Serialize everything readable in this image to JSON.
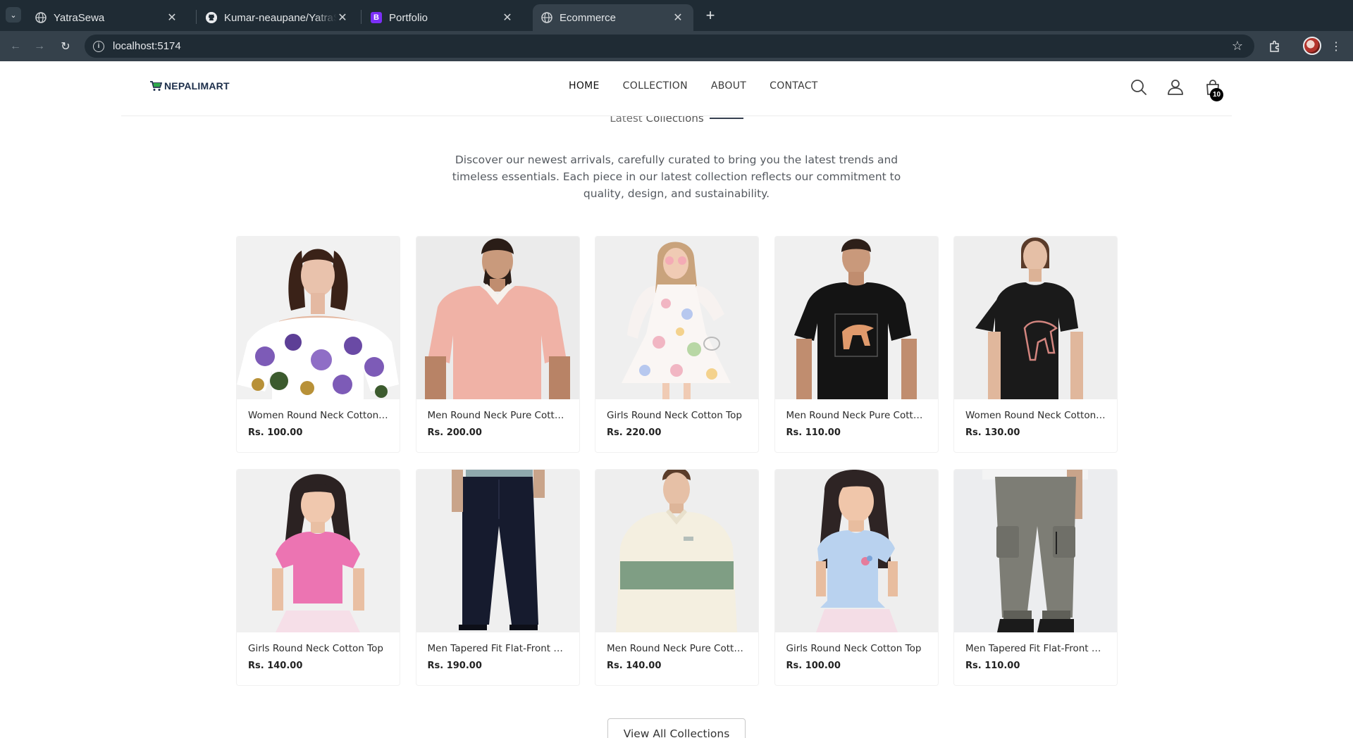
{
  "browser": {
    "tabs": [
      {
        "title": "YatraSewa",
        "icon": "globe-icon",
        "active": false
      },
      {
        "title": "Kumar-neaupane/YatraS",
        "icon": "github-icon",
        "active": false
      },
      {
        "title": "Portfolio",
        "icon": "bootstrap-icon",
        "active": false
      },
      {
        "title": "Ecommerce",
        "icon": "globe-icon",
        "active": true
      }
    ],
    "url": "localhost:5174"
  },
  "site": {
    "logo": "NEPALIMART",
    "nav": [
      {
        "label": "HOME",
        "active": true
      },
      {
        "label": "COLLECTION",
        "active": false
      },
      {
        "label": "ABOUT",
        "active": false
      },
      {
        "label": "CONTACT",
        "active": false
      }
    ],
    "cart_count": "10"
  },
  "section": {
    "heading_part1": "Latest",
    "heading_part2": "Collections",
    "description": "Discover our newest arrivals, carefully curated to bring you the latest trends and timeless essentials. Each piece in our latest collection reflects our commitment to quality, design, and sustainability."
  },
  "products": [
    {
      "name": "Women Round Neck Cotton …",
      "price": "Rs. 100.00",
      "image": "floral-off-shoulder-top"
    },
    {
      "name": "Men Round Neck Pure Cotto…",
      "price": "Rs. 200.00",
      "image": "pink-polo-shirt"
    },
    {
      "name": "Girls Round Neck Cotton Top",
      "price": "Rs. 220.00",
      "image": "floral-girls-dress"
    },
    {
      "name": "Men Round Neck Pure Cotto…",
      "price": "Rs. 110.00",
      "image": "black-puma-tshirt"
    },
    {
      "name": "Women Round Neck Cotton …",
      "price": "Rs. 130.00",
      "image": "black-puma-tshirt-women"
    },
    {
      "name": "Girls Round Neck Cotton Top",
      "price": "Rs. 140.00",
      "image": "pink-girls-top"
    },
    {
      "name": "Men Tapered Fit Flat-Front T…",
      "price": "Rs. 190.00",
      "image": "navy-trousers"
    },
    {
      "name": "Men Round Neck Pure Cotto…",
      "price": "Rs. 140.00",
      "image": "cream-green-sweatshirt"
    },
    {
      "name": "Girls Round Neck Cotton Top",
      "price": "Rs. 100.00",
      "image": "blue-girls-top"
    },
    {
      "name": "Men Tapered Fit Flat-Front T…",
      "price": "Rs. 110.00",
      "image": "grey-cargo-joggers"
    }
  ],
  "view_all_label": "View All Collections"
}
